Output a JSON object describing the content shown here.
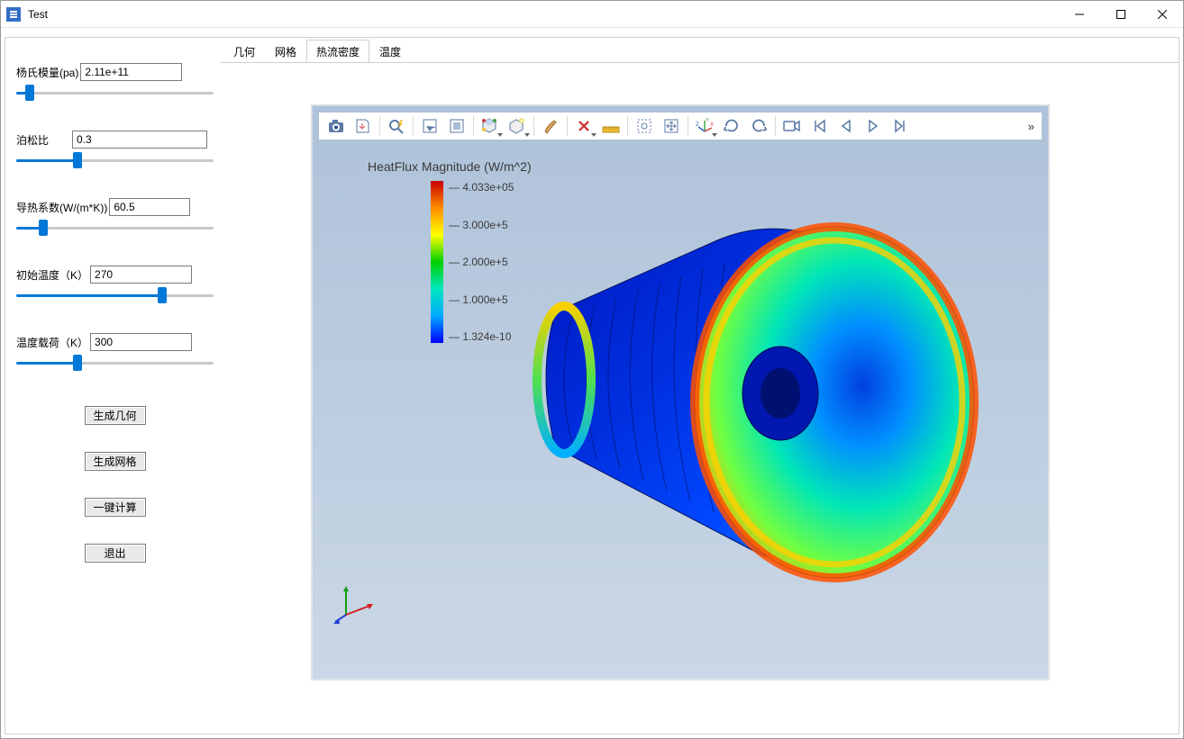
{
  "window": {
    "title": "Test"
  },
  "titlebar_icons": {
    "minimize": "minimize-icon",
    "maximize": "maximize-icon",
    "close": "close-icon"
  },
  "params": {
    "youngs_modulus": {
      "label": "杨氏模量(pa)",
      "value": "2.11e+11",
      "slider": 5
    },
    "poisson": {
      "label": "泊松比",
      "value": "0.3",
      "slider": 30
    },
    "thermal_cond": {
      "label": "导热系数(W/(m*K))",
      "value": "60.5",
      "slider": 12
    },
    "init_temp": {
      "label": "初始温度（K）",
      "value": "270",
      "slider": 75
    },
    "temp_load": {
      "label": "温度载荷（K）",
      "value": "300",
      "slider": 30
    }
  },
  "buttons": {
    "gen_geometry": "生成几何",
    "gen_mesh": "生成网格",
    "one_click_calc": "一键计算",
    "exit": "退出"
  },
  "tabs": [
    {
      "id": "geometry",
      "label": "几何",
      "active": false
    },
    {
      "id": "mesh",
      "label": "网格",
      "active": false
    },
    {
      "id": "heatflux",
      "label": "热流密度",
      "active": true
    },
    {
      "id": "temperature",
      "label": "温度",
      "active": false
    }
  ],
  "toolbar_icons": [
    "camera-icon",
    "export-icon",
    "zoom-lightning-icon",
    "select-box-icon",
    "frame-icon",
    "cube-colors-icon",
    "cube-light-icon",
    "brush-icon",
    "clear-x-icon",
    "ruler-icon",
    "selection-dashed-icon",
    "fit-icon",
    "axes-icon",
    "rotate-cw-icon",
    "rotate-ccw-icon",
    "camera-record-icon",
    "skip-start-icon",
    "step-back-icon",
    "play-icon",
    "step-forward-icon"
  ],
  "toolbar_separators_after": [
    1,
    2,
    4,
    6,
    7,
    9,
    11,
    14
  ],
  "legend": {
    "title": "HeatFlux Magnitude (W/m^2)",
    "ticks": [
      "4.033e+05",
      "3.000e+5",
      "2.000e+5",
      "1.000e+5",
      "1.324e-10"
    ]
  },
  "axes_gizmo": {
    "x": "X",
    "y": "Y",
    "z": "Z"
  }
}
